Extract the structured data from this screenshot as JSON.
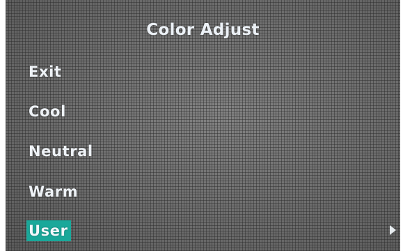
{
  "menu": {
    "title": "Color Adjust",
    "items": [
      {
        "label": "Exit"
      },
      {
        "label": "Cool"
      },
      {
        "label": "Neutral"
      },
      {
        "label": "Warm"
      },
      {
        "label": "User",
        "selected": true,
        "has_submenu": true
      }
    ]
  },
  "icons": {
    "submenu_indicator": "chevron-right-icon"
  },
  "colors": {
    "selection_highlight": "#1aa89a",
    "text": "#eef2f6",
    "background": "#6f6f6f"
  }
}
